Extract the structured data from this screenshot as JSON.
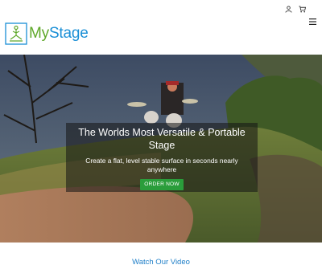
{
  "brand": {
    "name_part1": "My",
    "name_part2": "Stage",
    "color_green": "#5fa82a",
    "color_blue": "#1a8fd6"
  },
  "header": {
    "icons": [
      "user-icon",
      "cart-icon",
      "hamburger-menu-icon"
    ]
  },
  "hero": {
    "title": "The Worlds Most Versatile & Portable Stage",
    "subtitle": "Create a flat, level stable surface in seconds nearly anywhere",
    "cta_label": "ORDER NOW",
    "cta_color": "#2a9d3b"
  },
  "video_section": {
    "heading": "Watch Our Video"
  }
}
